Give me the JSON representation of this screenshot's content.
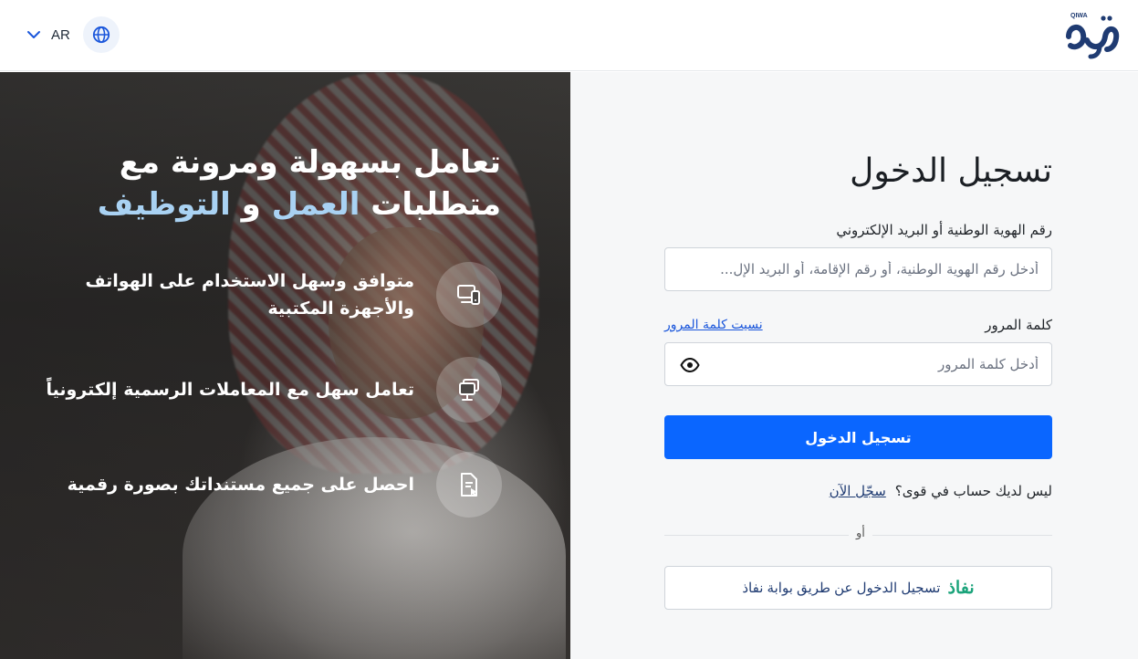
{
  "header": {
    "lang_code": "AR",
    "logo_text": "QIWA",
    "icons": {
      "chevron": "chevron-down-icon",
      "globe": "globe-icon"
    },
    "colors": {
      "logo": "#1f3b72"
    }
  },
  "hero": {
    "title_part1": "تعامل بسهولة ومرونة مع متطلبات",
    "title_hl1": "العمل",
    "title_and": "و",
    "title_hl2": "التوظيف",
    "features": [
      {
        "icon": "devices-icon",
        "text": "متوافق وسهل الاستخدام على الهواتف والأجهزة المكتبية"
      },
      {
        "icon": "desktop-icon",
        "text": "تعامل سهل مع المعاملات الرسمية إلكترونياً"
      },
      {
        "icon": "document-icon",
        "text": "احصل على جميع مستنداتك بصورة رقمية"
      }
    ],
    "colors": {
      "highlight": "#a9d2f3"
    }
  },
  "login": {
    "title": "تسجيل الدخول",
    "id_label": "رقم الهوية الوطنية أو البريد الإلكتروني",
    "id_placeholder": "أدخل رقم الهوية الوطنية، أو رقم الإقامة، أو البريد الإل...",
    "password_label": "كلمة المرور",
    "forgot_password": "نسيت كلمة المرور",
    "password_placeholder": "أدخل كلمة المرور",
    "submit_label": "تسجيل الدخول",
    "no_account": "ليس لديك حساب في قوى؟",
    "register_now": "سجّل الآن",
    "or": "أو",
    "nafath_brand": "نفاذ",
    "nafath_label": "تسجيل الدخول عن طريق بوابة نفاذ",
    "colors": {
      "primary": "#0a66ff",
      "nafath": "#1aa37a"
    }
  }
}
